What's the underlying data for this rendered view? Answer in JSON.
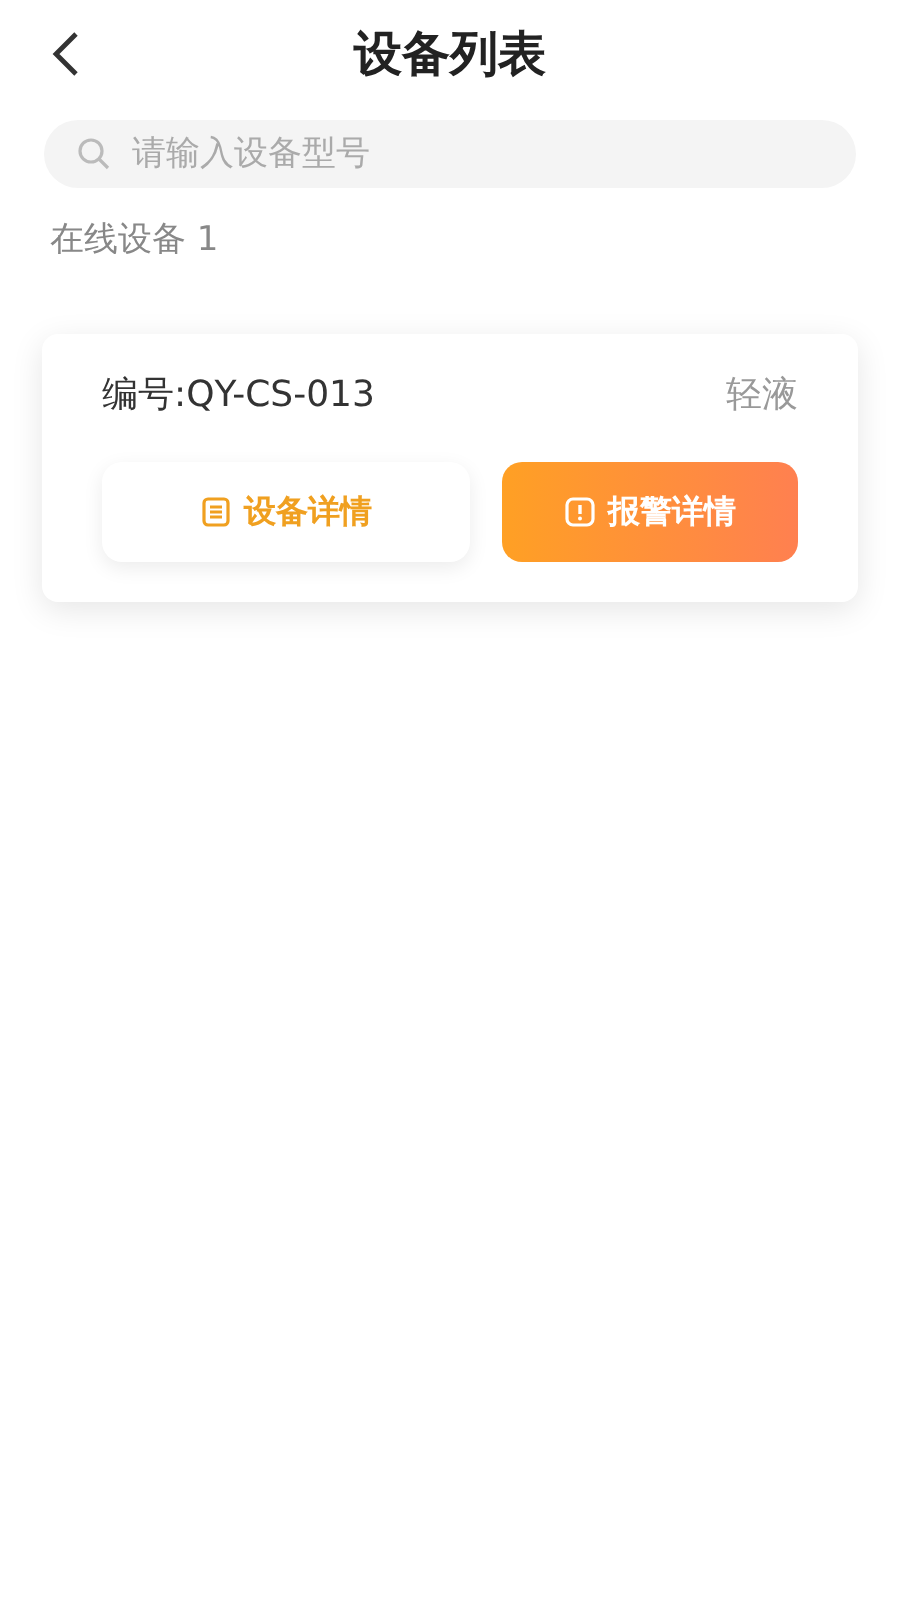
{
  "header": {
    "title": "设备列表"
  },
  "search": {
    "placeholder": "请输入设备型号"
  },
  "online_count": "在线设备 1",
  "devices": [
    {
      "code": "编号:QY-CS-013",
      "type": "轻液",
      "buttons": [
        {
          "kind": "details",
          "label": "设备详情"
        },
        {
          "kind": "alarm",
          "label": "报警详情"
        }
      ]
    }
  ]
}
